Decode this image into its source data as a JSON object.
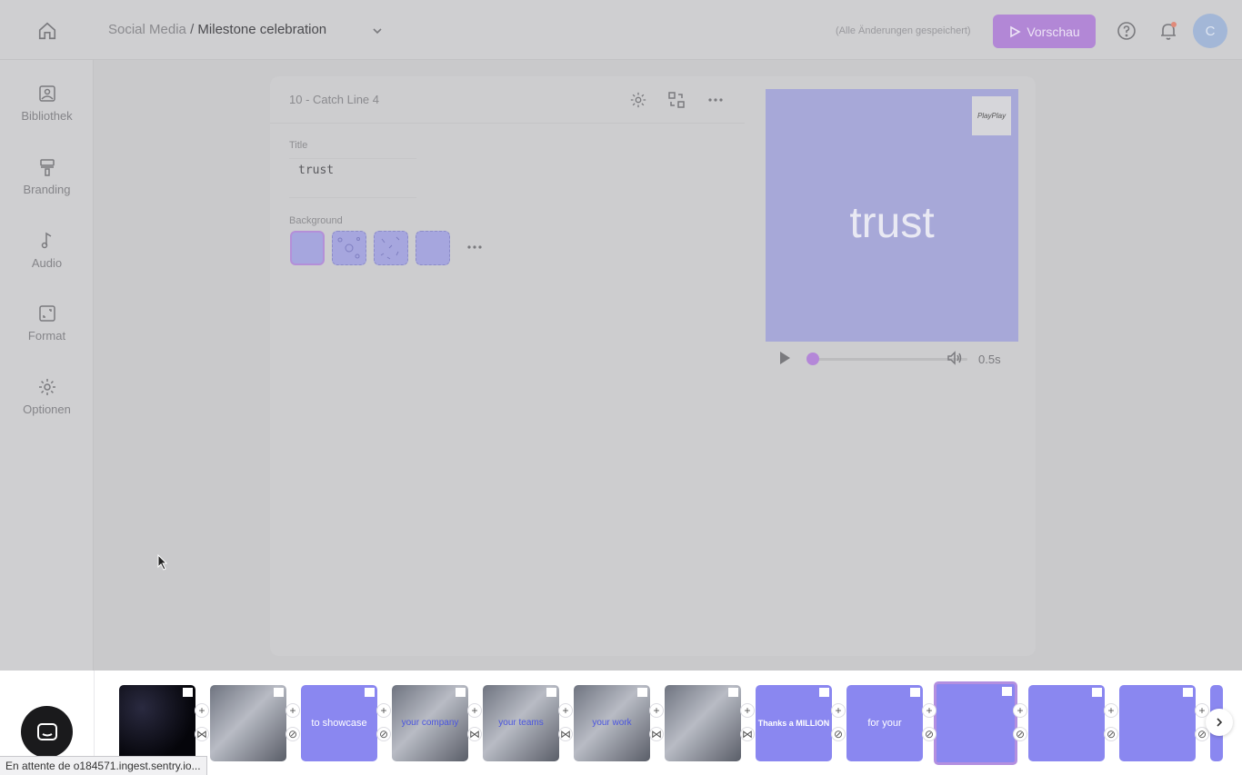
{
  "header": {
    "breadcrumb_project": "Social Media",
    "breadcrumb_sep": "/",
    "breadcrumb_video": "Milestone celebration",
    "saved_status": "(Alle Änderungen gespeichert)",
    "preview_label": "Vorschau",
    "avatar_initial": "C",
    "accent_color": "#b287d6"
  },
  "sidebar": {
    "items": [
      {
        "label": "Bibliothek",
        "icon": "image-icon"
      },
      {
        "label": "Branding",
        "icon": "paint-roller-icon"
      },
      {
        "label": "Audio",
        "icon": "music-note-icon"
      },
      {
        "label": "Format",
        "icon": "resize-icon"
      },
      {
        "label": "Optionen",
        "icon": "gear-icon"
      }
    ]
  },
  "editor": {
    "scene_name": "10 - Catch Line 4",
    "title_label": "Title",
    "title_value": "trust",
    "background_label": "Background"
  },
  "preview": {
    "text": "trust",
    "logo_text": "PlayPlay",
    "time": "0.5s",
    "progress": 0.0
  },
  "timeline": {
    "clips": [
      {
        "type": "dark",
        "text": ""
      },
      {
        "type": "photo",
        "text": ""
      },
      {
        "type": "purple",
        "text": "to showcase"
      },
      {
        "type": "photo",
        "text": "your company"
      },
      {
        "type": "photo",
        "text": "your teams"
      },
      {
        "type": "photo",
        "text": "your work"
      },
      {
        "type": "photo",
        "text": ""
      },
      {
        "type": "purple",
        "text": "Thanks a MILLION"
      },
      {
        "type": "purple",
        "text": "for your"
      },
      {
        "type": "purple",
        "text": "",
        "selected": true
      },
      {
        "type": "purple",
        "text": ""
      },
      {
        "type": "purple",
        "text": ""
      }
    ]
  },
  "status_bar": "En attente de o184571.ingest.sentry.io..."
}
